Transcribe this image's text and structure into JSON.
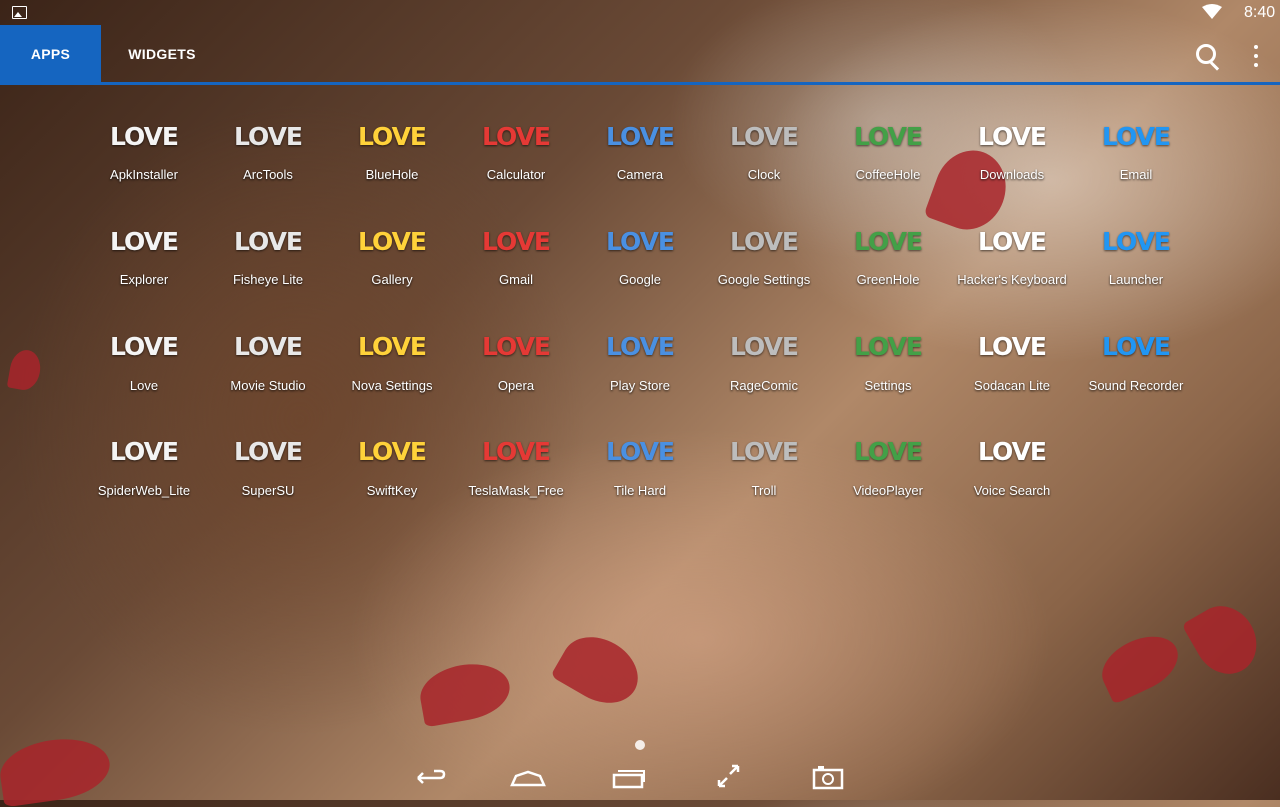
{
  "status_bar": {
    "time": "8:40",
    "wifi_icon": "wifi-icon",
    "notification_icon": "image-icon"
  },
  "header": {
    "tabs": [
      {
        "label": "APPS",
        "selected": true
      },
      {
        "label": "WIDGETS",
        "selected": false
      }
    ],
    "accent_color": "#1565c0",
    "search_icon": "search-icon",
    "menu_icon": "overflow-menu-icon"
  },
  "apps": [
    {
      "label": "ApkInstaller",
      "icon_text": "LOVE"
    },
    {
      "label": "ArcTools",
      "icon_text": "LOVE"
    },
    {
      "label": "BlueHole",
      "icon_text": "LOVE"
    },
    {
      "label": "Calculator",
      "icon_text": "LOVE"
    },
    {
      "label": "Camera",
      "icon_text": "LOVE"
    },
    {
      "label": "Clock",
      "icon_text": "LOVE"
    },
    {
      "label": "CoffeeHole",
      "icon_text": "LOVE"
    },
    {
      "label": "Downloads",
      "icon_text": "LOVE"
    },
    {
      "label": "Email",
      "icon_text": "LOVE"
    },
    {
      "label": "Explorer",
      "icon_text": "LOVE"
    },
    {
      "label": "Fisheye Lite",
      "icon_text": "LOVE"
    },
    {
      "label": "Gallery",
      "icon_text": "LOVE"
    },
    {
      "label": "Gmail",
      "icon_text": "LOVE"
    },
    {
      "label": "Google",
      "icon_text": "LOVE"
    },
    {
      "label": "Google Settings",
      "icon_text": "LOVE"
    },
    {
      "label": "GreenHole",
      "icon_text": "LOVE"
    },
    {
      "label": "Hacker's Keyboard",
      "icon_text": "LOVE"
    },
    {
      "label": "Launcher",
      "icon_text": "LOVE"
    },
    {
      "label": "Love",
      "icon_text": "LOVE"
    },
    {
      "label": "Movie Studio",
      "icon_text": "LOVE"
    },
    {
      "label": "Nova Settings",
      "icon_text": "LOVE"
    },
    {
      "label": "Opera",
      "icon_text": "LOVE"
    },
    {
      "label": "Play Store",
      "icon_text": "LOVE"
    },
    {
      "label": "RageComic",
      "icon_text": "LOVE"
    },
    {
      "label": "Settings",
      "icon_text": "LOVE"
    },
    {
      "label": "Sodacan Lite",
      "icon_text": "LOVE"
    },
    {
      "label": "Sound Recorder",
      "icon_text": "LOVE"
    },
    {
      "label": "SpiderWeb_Lite",
      "icon_text": "LOVE"
    },
    {
      "label": "SuperSU",
      "icon_text": "LOVE"
    },
    {
      "label": "SwiftKey",
      "icon_text": "LOVE"
    },
    {
      "label": "TeslaMask_Free",
      "icon_text": "LOVE"
    },
    {
      "label": "Tile Hard",
      "icon_text": "LOVE"
    },
    {
      "label": "Troll",
      "icon_text": "LOVE"
    },
    {
      "label": "VideoPlayer",
      "icon_text": "LOVE"
    },
    {
      "label": "Voice Search",
      "icon_text": "LOVE"
    }
  ],
  "icon_colors": [
    "#f4f4f4",
    "#e8e8e8",
    "#ffd23a",
    "#e53935",
    "#4a90e2",
    "#bdbdbd",
    "#43a047",
    "#ffffff",
    "#2196f3"
  ],
  "page_indicator": {
    "pages": 1,
    "current": 1
  },
  "nav_bar": {
    "buttons": [
      "back-icon",
      "home-icon",
      "recents-icon",
      "expand-icon",
      "screenshot-icon"
    ]
  }
}
